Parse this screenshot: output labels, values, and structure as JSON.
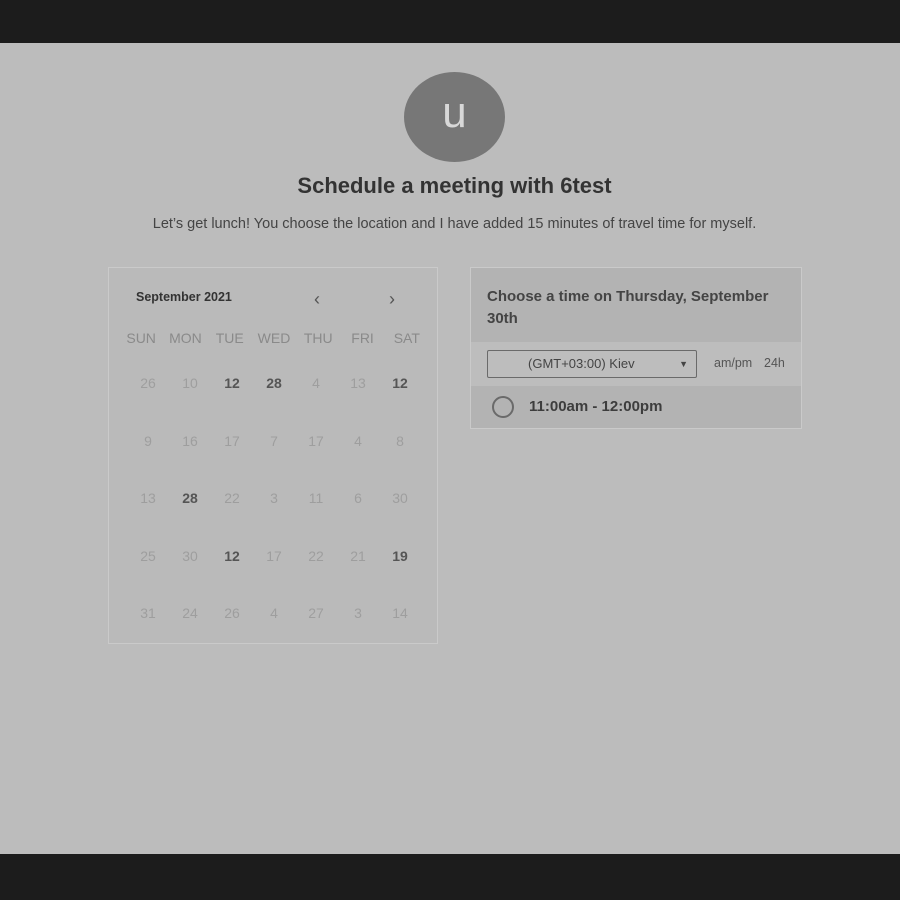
{
  "avatar": {
    "initial": "u"
  },
  "title": "Schedule a meeting with 6test",
  "subtitle": "Let’s get lunch! You choose the location and I have added 15 minutes of travel time for myself.",
  "calendar": {
    "month_label": "September 2021",
    "prev_icon": "‹",
    "next_icon": "›",
    "weekdays": [
      "SUN",
      "MON",
      "TUE",
      "WED",
      "THU",
      "FRI",
      "SAT"
    ],
    "days": [
      {
        "label": "26",
        "available": false
      },
      {
        "label": "10",
        "available": false
      },
      {
        "label": "12",
        "available": true
      },
      {
        "label": "28",
        "available": true
      },
      {
        "label": "4",
        "available": false
      },
      {
        "label": "13",
        "available": false
      },
      {
        "label": "12",
        "available": true
      },
      {
        "label": "9",
        "available": false
      },
      {
        "label": "16",
        "available": false
      },
      {
        "label": "17",
        "available": false
      },
      {
        "label": "7",
        "available": false
      },
      {
        "label": "17",
        "available": false
      },
      {
        "label": "4",
        "available": false
      },
      {
        "label": "8",
        "available": false
      },
      {
        "label": "13",
        "available": false
      },
      {
        "label": "28",
        "available": true
      },
      {
        "label": "22",
        "available": false
      },
      {
        "label": "3",
        "available": false
      },
      {
        "label": "11",
        "available": false
      },
      {
        "label": "6",
        "available": false
      },
      {
        "label": "30",
        "available": false
      },
      {
        "label": "25",
        "available": false
      },
      {
        "label": "30",
        "available": false
      },
      {
        "label": "12",
        "available": true
      },
      {
        "label": "17",
        "available": false
      },
      {
        "label": "22",
        "available": false
      },
      {
        "label": "21",
        "available": false
      },
      {
        "label": "19",
        "available": true
      },
      {
        "label": "31",
        "available": false
      },
      {
        "label": "24",
        "available": false
      },
      {
        "label": "26",
        "available": false
      },
      {
        "label": "4",
        "available": false
      },
      {
        "label": "27",
        "available": false
      },
      {
        "label": "3",
        "available": false
      },
      {
        "label": "14",
        "available": false
      }
    ]
  },
  "times": {
    "heading": "Choose a time on Thursday, September 30th",
    "timezone": "(GMT+03:00) Kiev",
    "dropdown_icon": "▼",
    "format_ampm": "am/pm",
    "format_24h": "24h",
    "slots": [
      {
        "label": "11:00am - 12:00pm"
      }
    ]
  }
}
